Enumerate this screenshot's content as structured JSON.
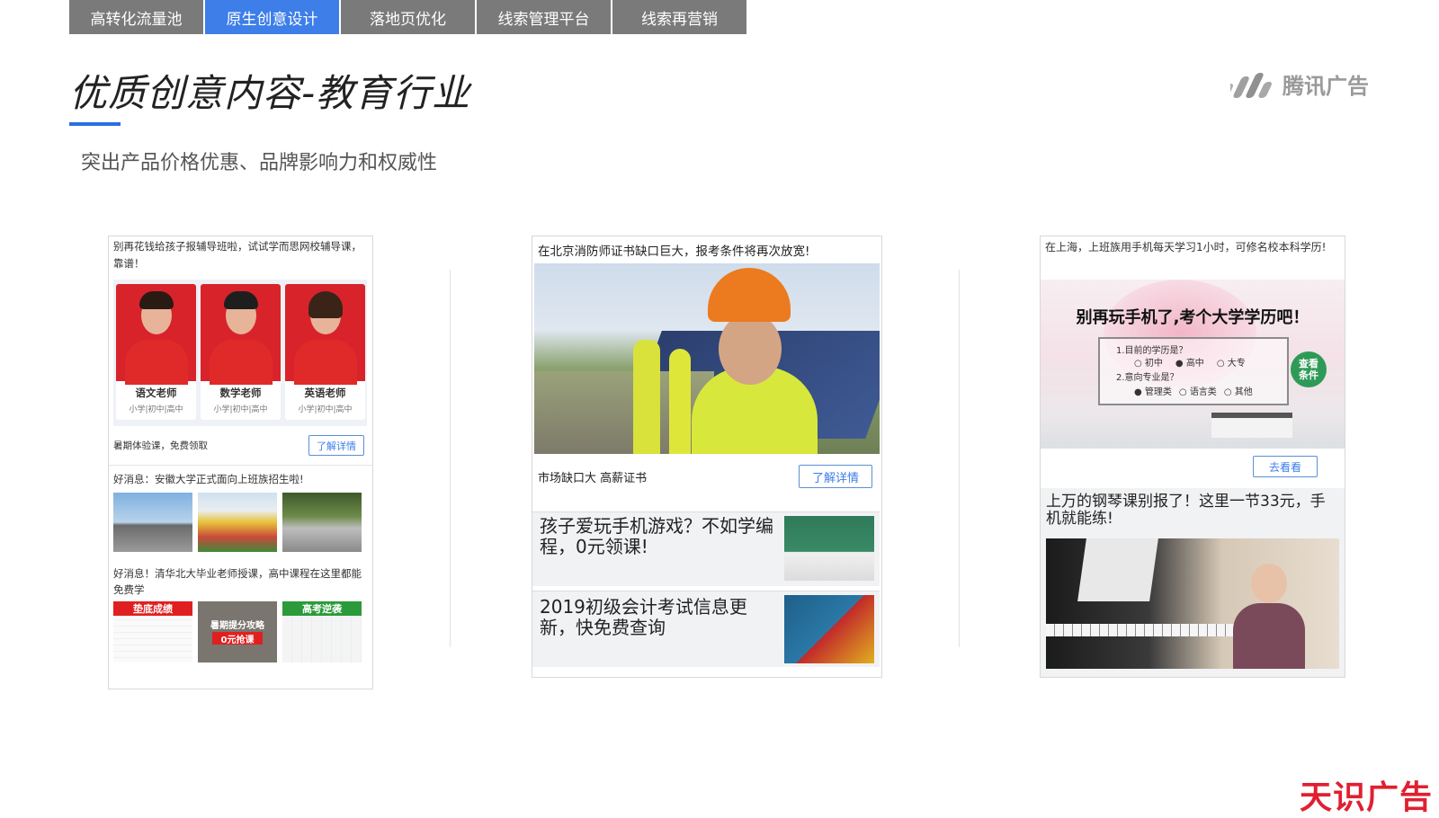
{
  "tabs": [
    {
      "label": "高转化流量池"
    },
    {
      "label": "原生创意设计"
    },
    {
      "label": "落地页优化"
    },
    {
      "label": "线索管理平台"
    },
    {
      "label": "线索再营销"
    }
  ],
  "active_tab": "原生创意设计",
  "page": {
    "title": "优质创意内容-教育行业",
    "subtitle": "突出产品价格优惠、品牌影响力和权威性"
  },
  "logo": {
    "text": "腾讯广告"
  },
  "footer_brand": "天识广告",
  "card1": {
    "caption": "别再花钱给孩子报辅导班啦，试试学而思网校辅导课，靠谱！",
    "teachers": [
      {
        "name": "语文老师",
        "levels": "小学|初中|高中"
      },
      {
        "name": "数学老师",
        "levels": "小学|初中|高中"
      },
      {
        "name": "英语老师",
        "levels": "小学|初中|高中"
      }
    ],
    "promo_text": "暑期体验课，免费领取",
    "cta_label": "了解详情",
    "news1": "好消息：安徽大学正式面向上班族招生啦!",
    "news2": "好消息！清华北大毕业老师授课，高中课程在这里都能免费学",
    "tags": [
      "垫底成绩",
      "暑期提分攻略",
      "高考逆袭"
    ],
    "badge": "0元抢课",
    "colors": {
      "tag_red": "#e02020",
      "tag_green": "#2b9a3a"
    }
  },
  "card2": {
    "caption": "在北京消防师证书缺口巨大，报考条件将再次放宽!",
    "promo_text": "市场缺口大 高薪证书",
    "cta_label": "了解详情",
    "news1": "孩子爱玩手机游戏？不如学编程，0元领课!",
    "news2": "2019初级会计考试信息更新，快免费查询"
  },
  "card3": {
    "caption": "在上海，上班族用手机每天学习1小时，可修名校本科学历!",
    "headline": "别再玩手机了,考个大学学历吧！",
    "q1": "1.目前的学历是？",
    "q1_options": [
      "初中",
      "高中",
      "大专"
    ],
    "q2": "2.意向专业是？",
    "q2_options": [
      "管理类",
      "语言类",
      "其他"
    ],
    "check_label": "查看条件",
    "cta_label": "去看看",
    "news1": "上万的钢琴课别报了！这里一节33元，手机就能练!"
  }
}
